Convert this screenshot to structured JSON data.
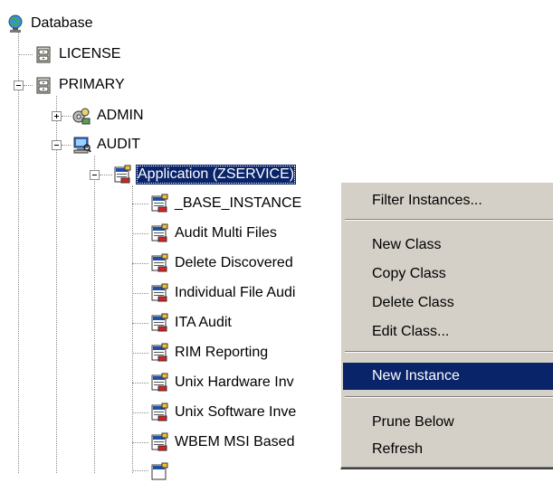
{
  "tree": {
    "root": "Database",
    "license": "LICENSE",
    "primary": "PRIMARY",
    "admin": "ADMIN",
    "audit": "AUDIT",
    "application": "Application (ZSERVICE)",
    "children": [
      "_BASE_INSTANCE",
      "Audit Multi Files",
      "Delete Discovered",
      "Individual File Audi",
      "ITA Audit",
      "RIM Reporting",
      "Unix Hardware Inv",
      "Unix Software Inve",
      "WBEM MSI Based"
    ]
  },
  "context_menu": {
    "filter_instances": "Filter Instances...",
    "new_class": "New Class",
    "copy_class": "Copy Class",
    "delete_class": "Delete Class",
    "edit_class": "Edit Class...",
    "new_instance": "New Instance",
    "prune_below": "Prune Below",
    "refresh": "Refresh"
  },
  "colors": {
    "selection": "#0a246a",
    "menu_face": "#d4d0c8",
    "tree_lines": "#8c8c8c"
  }
}
